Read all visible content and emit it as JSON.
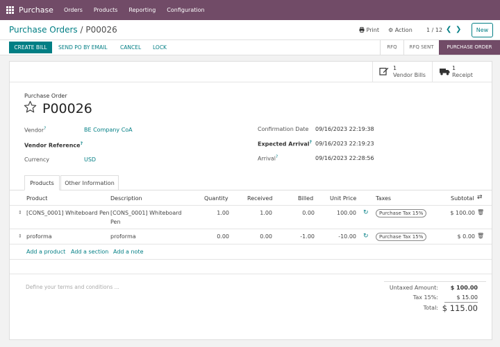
{
  "navbar": {
    "app_name": "Purchase",
    "menu": [
      "Orders",
      "Products",
      "Reporting",
      "Configuration"
    ]
  },
  "control": {
    "breadcrumb_parent": "Purchase Orders",
    "breadcrumb_sep": "/",
    "breadcrumb_current": "P00026",
    "print_label": "Print",
    "action_label": "Action",
    "pager": "1 / 12",
    "new_label": "New"
  },
  "status": {
    "buttons": [
      "CREATE BILL",
      "SEND PO BY EMAIL",
      "CANCEL",
      "LOCK"
    ],
    "stages": [
      "RFQ",
      "RFQ SENT",
      "PURCHASE ORDER"
    ],
    "active_stage": "PURCHASE ORDER"
  },
  "smart_buttons": {
    "bills": {
      "count": "1",
      "label": "Vendor Bills"
    },
    "receipt": {
      "count": "1",
      "label": "Receipt"
    }
  },
  "form": {
    "subtitle": "Purchase Order",
    "title": "P00026",
    "vendor_label": "Vendor",
    "vendor_value": "BE Company CoA",
    "vendor_ref_label": "Vendor Reference",
    "currency_label": "Currency",
    "currency_value": "USD",
    "confirmation_label": "Confirmation Date",
    "confirmation_value": "09/16/2023 22:19:38",
    "expected_label": "Expected Arrival",
    "expected_value": "09/16/2023 22:19:23",
    "arrival_label": "Arrival",
    "arrival_value": "09/16/2023 22:28:56",
    "help_mark": "?"
  },
  "tabs": [
    "Products",
    "Other Information"
  ],
  "table": {
    "headers": [
      "Product",
      "Description",
      "Quantity",
      "Received",
      "Billed",
      "Unit Price",
      "Taxes",
      "Subtotal"
    ],
    "rows": [
      {
        "product": "[CONS_0001] Whiteboard Pen",
        "description_1": "[CONS_0001] Whiteboard",
        "description_2": "Pen",
        "quantity": "1.00",
        "received": "1.00",
        "billed": "0.00",
        "unit_price": "100.00",
        "tax": "Purchase Tax 15%",
        "subtotal": "$ 100.00"
      },
      {
        "product": "proforma",
        "description_1": "proforma",
        "description_2": "",
        "quantity": "0.00",
        "received": "0.00",
        "billed": "-1.00",
        "unit_price": "-10.00",
        "tax": "Purchase Tax 15%",
        "subtotal": "$ 0.00"
      }
    ],
    "add_product": "Add a product",
    "add_section": "Add a section",
    "add_note": "Add a note"
  },
  "terms_placeholder": "Define your terms and conditions ...",
  "totals": {
    "untaxed_label": "Untaxed Amount:",
    "untaxed_value": "$ 100.00",
    "tax_label": "Tax 15%:",
    "tax_value": "$ 15.00",
    "total_label": "Total:",
    "total_value": "$ 115.00"
  },
  "colors": {
    "brand": "#714b67",
    "accent": "#017e84"
  }
}
